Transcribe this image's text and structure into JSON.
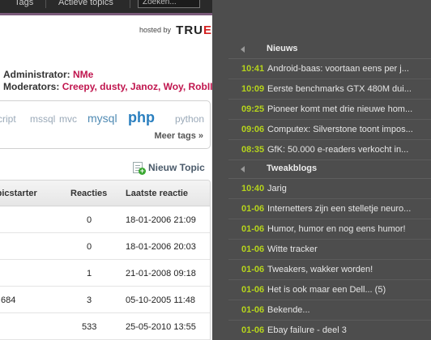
{
  "topbar": {
    "tags_label": "Tags",
    "active_label": "Actieve topics",
    "search_placeholder": "Zoeken..."
  },
  "hosted": {
    "label": "hosted by",
    "logo_main": "TRU",
    "logo_accent": "E"
  },
  "staff": {
    "admin_label": "Administrator:",
    "admin_name": "NMe",
    "moderators_label": "Moderators:",
    "moderator_names": "Creepy, dusty, Janoz, Woy, RobIII"
  },
  "tags": {
    "items": [
      "script",
      "mssql",
      "mvc",
      "mysql",
      "php",
      "python"
    ],
    "more": "Meer tags »"
  },
  "new_topic": {
    "label": "Nieuw Topic"
  },
  "topics_table": {
    "columns": [
      "Topicstarter",
      "Reacties",
      "Laatste reactie"
    ],
    "rows": [
      {
        "starter": "",
        "replies": "0",
        "last": "18-01-2006 21:09"
      },
      {
        "starter": "",
        "replies": "0",
        "last": "18-01-2006 20:03"
      },
      {
        "starter": "",
        "replies": "1",
        "last": "21-01-2008 09:18"
      },
      {
        "starter": "684",
        "replies": "3",
        "last": "05-10-2005 11:48"
      },
      {
        "starter": "",
        "replies": "533",
        "last": "25-05-2010 13:55"
      }
    ]
  },
  "sidebar": {
    "sections": [
      {
        "title": "Nieuws",
        "items": [
          {
            "time": "10:41",
            "text": "Android-baas: voortaan eens per j..."
          },
          {
            "time": "10:09",
            "text": "Eerste benchmarks GTX 480M dui..."
          },
          {
            "time": "09:25",
            "text": "Pioneer komt met drie nieuwe hom..."
          },
          {
            "time": "09:06",
            "text": "Computex: Silverstone toont impos..."
          },
          {
            "time": "08:35",
            "text": "GfK: 50.000 e-readers verkocht in..."
          }
        ]
      },
      {
        "title": "Tweakblogs",
        "items": [
          {
            "time": "10:40",
            "text": "Jarig"
          },
          {
            "time": "01-06",
            "text": "Internetters zijn een stelletje neuro..."
          },
          {
            "time": "01-06",
            "text": "Humor, humor en nog eens humor!"
          },
          {
            "time": "01-06",
            "text": "Witte tracker"
          },
          {
            "time": "01-06",
            "text": "Tweakers, wakker worden!"
          },
          {
            "time": "01-06",
            "text": "Het is ook maar een Dell... (5)"
          },
          {
            "time": "01-06",
            "text": "Bekende..."
          },
          {
            "time": "01-06",
            "text": "Ebay failure - deel 3"
          }
        ]
      }
    ]
  }
}
